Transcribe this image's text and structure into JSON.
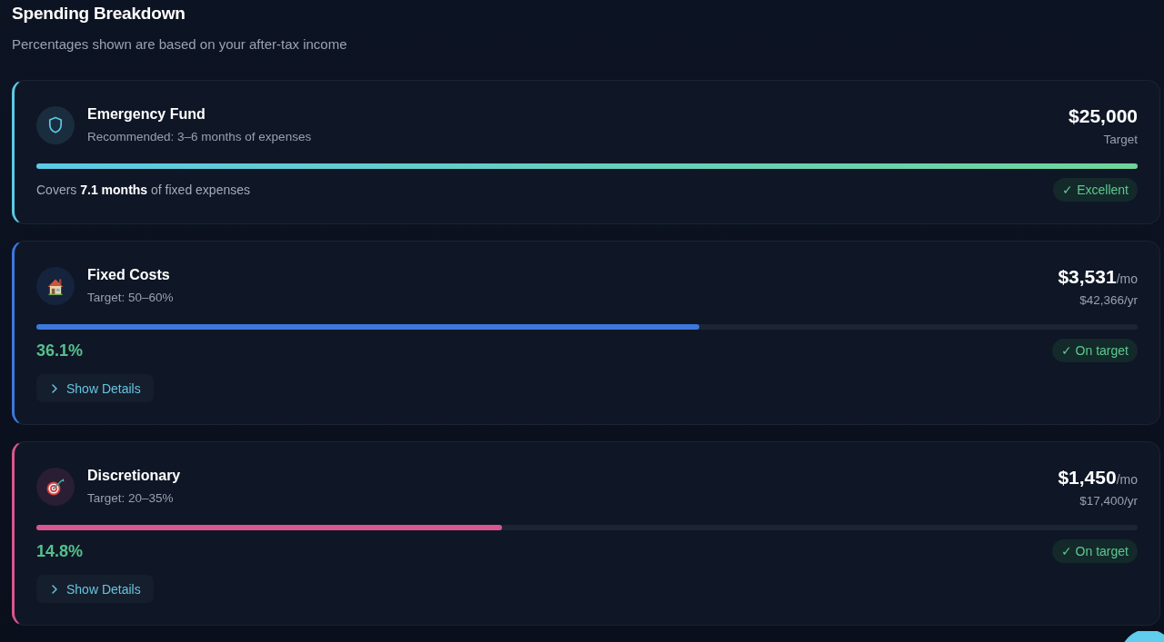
{
  "header": {
    "title": "Spending Breakdown",
    "subtitle": "Percentages shown are based on your after-tax income"
  },
  "categories": [
    {
      "kind": "fund",
      "title": "Emergency Fund",
      "subtitle": "Recommended: 3–6 months of expenses",
      "amount": "$25,000",
      "amount_note": "Target",
      "color": "#5cc9e6",
      "level": 1,
      "summary": "Covers **7.1 months** of fixed expenses",
      "badge": "✓ Excellent"
    },
    {
      "kind": "budget",
      "title": "Fixed Costs",
      "subtitle": "Target: 50–60%",
      "amount": "$3,531",
      "unit": "/mo",
      "amount_note": "$42,366/yr",
      "color": "#3d78dc",
      "level": 0.602,
      "percent": "36.1%",
      "badge": "✓ On target",
      "details": {
        "label": "Show Details",
        "expanded": false
      }
    },
    {
      "kind": "budget",
      "title": "Discretionary",
      "subtitle": "Target: 20–35%",
      "amount": "$1,450",
      "unit": "/mo",
      "amount_note": "$17,400/yr",
      "color": "#d9578e",
      "level": 0.423,
      "percent": "14.8%",
      "badge": "✓ On target",
      "details": {
        "label": "Show Details",
        "expanded": false
      }
    }
  ]
}
